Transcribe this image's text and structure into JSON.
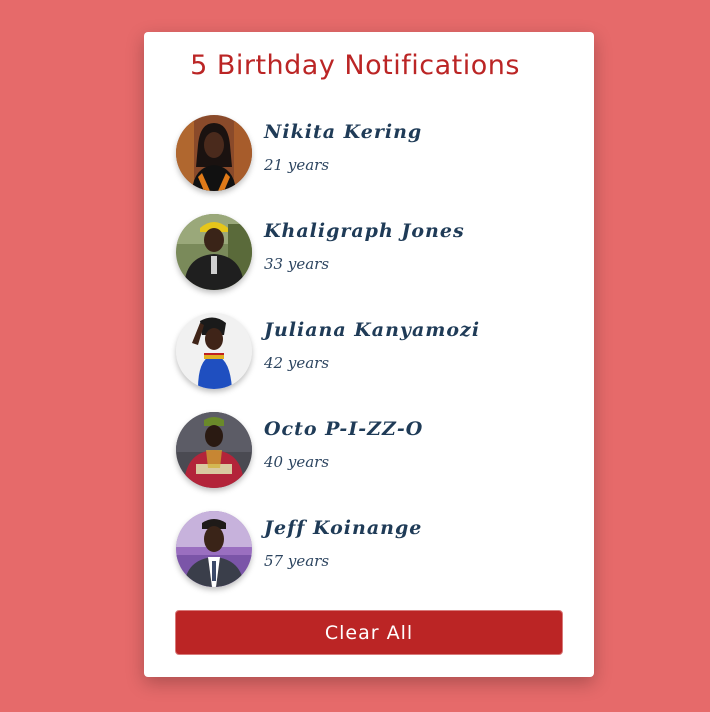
{
  "header": {
    "title": "5 Birthday Notifications"
  },
  "people": [
    {
      "name": "Nikita Kering",
      "age": "21 years",
      "avatar": "portrait-photo-1"
    },
    {
      "name": "Khaligraph Jones",
      "age": "33 years",
      "avatar": "portrait-photo-2"
    },
    {
      "name": "Juliana Kanyamozi",
      "age": "42 years",
      "avatar": "portrait-photo-3"
    },
    {
      "name": "Octo P-I-ZZ-O",
      "age": "40 years",
      "avatar": "portrait-photo-4"
    },
    {
      "name": "Jeff Koinange",
      "age": "57 years",
      "avatar": "portrait-photo-5"
    }
  ],
  "actions": {
    "clear_label": "Clear All"
  },
  "colors": {
    "page_background": "#e66a6a",
    "card_background": "#ffffff",
    "accent": "#bb2525",
    "name_text": "#1f3b57"
  }
}
